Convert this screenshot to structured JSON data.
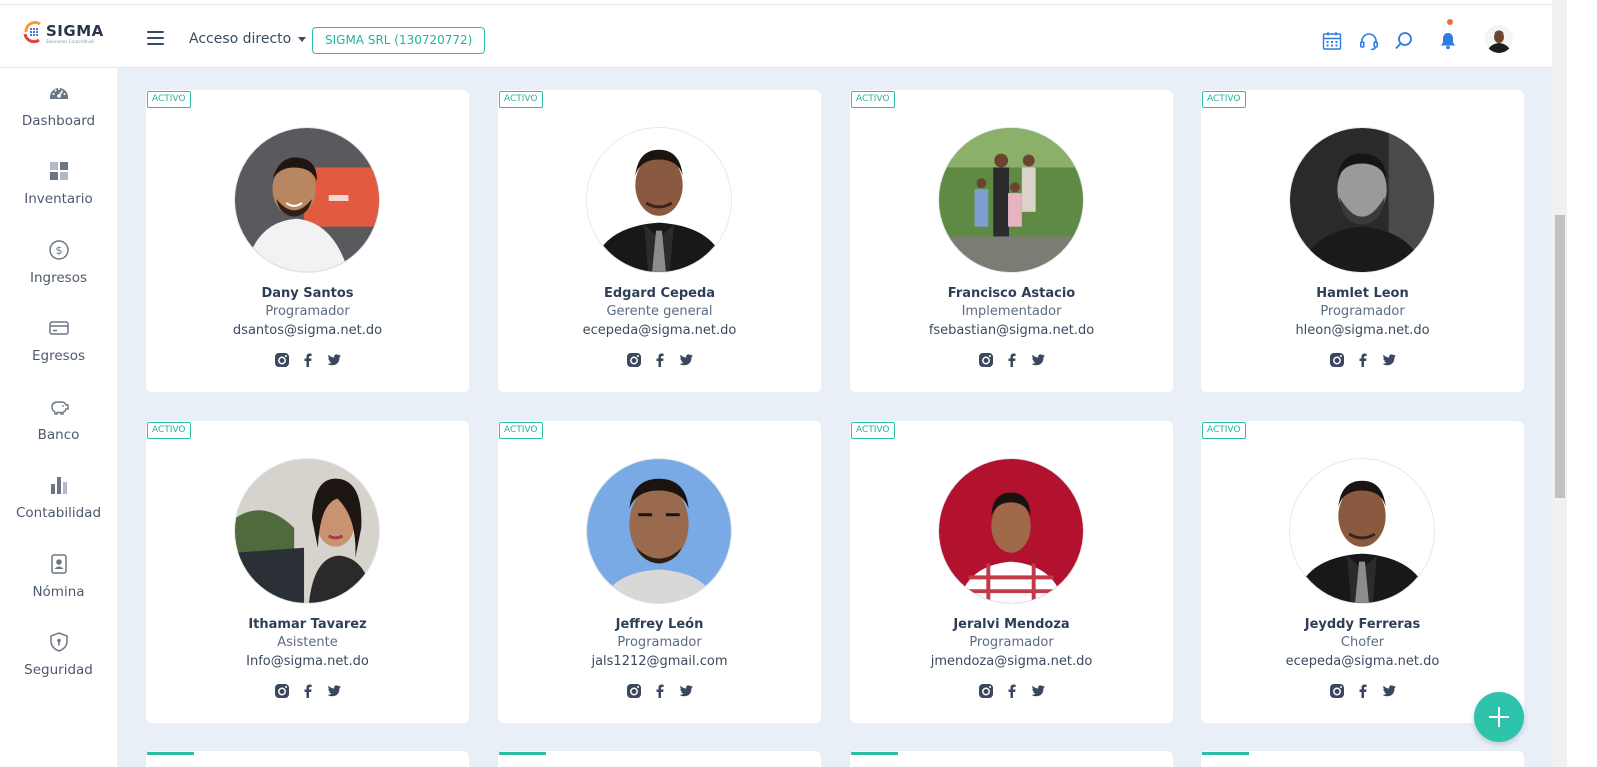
{
  "header": {
    "logo_text": "SIGMA",
    "logo_subtext": "Soluciones Corporativas",
    "shortcut_label": "Acceso directo",
    "company_label": "SIGMA SRL (130720772)",
    "icons": [
      "calendar-icon",
      "headset-icon",
      "search-icon",
      "bell-icon"
    ]
  },
  "sidebar": {
    "items": [
      {
        "label": "Dashboard",
        "icon": "gauge-icon"
      },
      {
        "label": "Inventario",
        "icon": "grid-icon"
      },
      {
        "label": "Ingresos",
        "icon": "dollar-icon"
      },
      {
        "label": "Egresos",
        "icon": "card-icon"
      },
      {
        "label": "Banco",
        "icon": "piggy-bank-icon"
      },
      {
        "label": "Contabilidad",
        "icon": "bar-chart-icon"
      },
      {
        "label": "Nómina",
        "icon": "id-badge-icon"
      },
      {
        "label": "Seguridad",
        "icon": "shield-icon"
      }
    ]
  },
  "employees": [
    {
      "status": "ACTIVO",
      "name": "Dany Santos",
      "role": "Programador",
      "email": "dsantos@sigma.net.do"
    },
    {
      "status": "ACTIVO",
      "name": "Edgard Cepeda",
      "role": "Gerente general",
      "email": "ecepeda@sigma.net.do"
    },
    {
      "status": "ACTIVO",
      "name": "Francisco Astacio",
      "role": "Implementador",
      "email": "fsebastian@sigma.net.do"
    },
    {
      "status": "ACTIVO",
      "name": "Hamlet Leon",
      "role": "Programador",
      "email": "hleon@sigma.net.do"
    },
    {
      "status": "ACTIVO",
      "name": "Ithamar Tavarez",
      "role": "Asistente",
      "email": "Info@sigma.net.do"
    },
    {
      "status": "ACTIVO",
      "name": "Jeffrey León",
      "role": "Programador",
      "email": "jals1212@gmail.com"
    },
    {
      "status": "ACTIVO",
      "name": "Jeralvi Mendoza",
      "role": "Programador",
      "email": "jmendoza@sigma.net.do"
    },
    {
      "status": "ACTIVO",
      "name": "Jeyddy Ferreras",
      "role": "Chofer",
      "email": "ecepeda@sigma.net.do"
    }
  ],
  "social_icons": [
    "instagram-icon",
    "facebook-icon",
    "twitter-icon"
  ],
  "colors": {
    "accent": "#2bbfa8",
    "page_bg": "#e9eff7",
    "text_dark": "#2f3e57",
    "icon_blue": "#2f7be0"
  }
}
